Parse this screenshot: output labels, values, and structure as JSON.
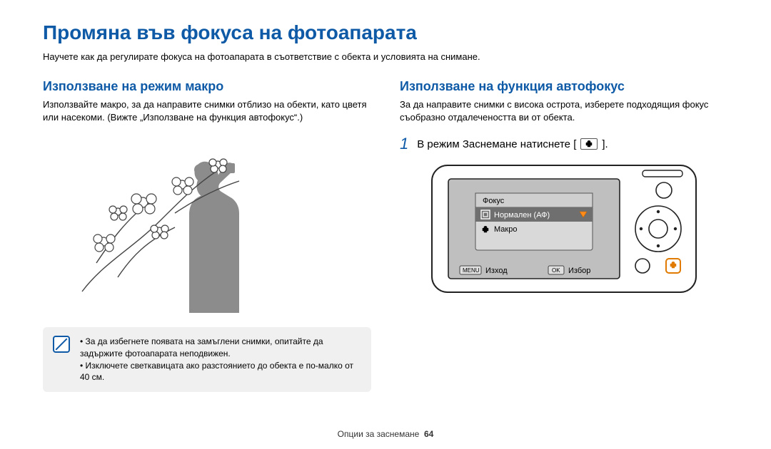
{
  "title": "Промяна във фокуса на фотоапарата",
  "subtitle": "Научете как да регулирате фокуса на фотоапарата в съответствие с обекта и условията на снимане.",
  "left": {
    "heading": "Използване на режим макро",
    "body": "Използвайте макро, за да направите снимки отблизо на обекти, като цветя или насекоми. (Вижте „Използване на функция автофокус“.)"
  },
  "right": {
    "heading": "Използване на функция автофокус",
    "body": "За да направите снимки с висока острота, изберете подходящия фокус съобразно отдалечеността ви от обекта.",
    "step_num": "1",
    "step_text_before": "В режим Заснемане натиснете [",
    "step_text_after": "].",
    "camera_menu": {
      "title": "Фокус",
      "items": [
        {
          "icon": "af-icon",
          "label": "Нормален (АФ)",
          "selected": true
        },
        {
          "icon": "macro-icon",
          "label": "Макро",
          "selected": false
        }
      ],
      "bottom_left_btn": "MENU",
      "bottom_left_label": "Изход",
      "bottom_right_btn": "OK",
      "bottom_right_label": "Избор"
    }
  },
  "notes": [
    "За да избегнете появата на замъглени снимки, опитайте да задържите фотоапарата неподвижен.",
    "Изключете светкавицата ако разстоянието до обекта е по-малко от 40 см."
  ],
  "footer_section": "Опции за заснемане",
  "footer_page": "64"
}
